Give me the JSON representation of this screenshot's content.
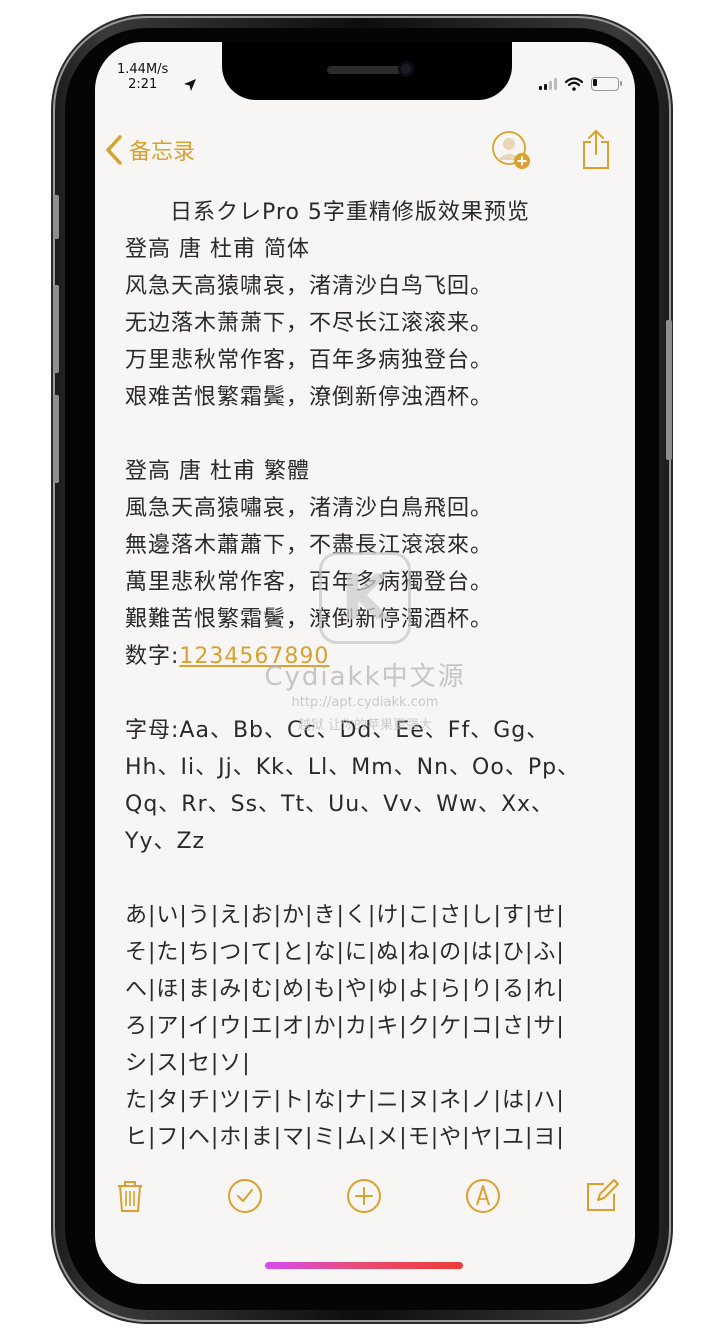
{
  "status_bar": {
    "speed": "1.44M/s",
    "time": "2:21"
  },
  "nav": {
    "back_label": "备忘录"
  },
  "note": {
    "lines": [
      "日系クレPro 5字重精修版效果预览",
      "登高 唐 杜甫 简体",
      "风急天高猿啸哀，渚清沙白鸟飞回。",
      "无边落木萧萧下，不尽长江滚滚来。",
      "万里悲秋常作客，百年多病独登台。",
      "艰难苦恨繁霜鬓，潦倒新停浊酒杯。",
      "",
      "登高 唐 杜甫 繁體",
      "風急天高猿嘯哀，渚清沙白鳥飛回。",
      "無邊落木蕭蕭下，不盡長江滾滾來。",
      "萬里悲秋常作客，百年多病獨登台。",
      "艱難苦恨繁霜鬢，潦倒新停濁酒杯。"
    ],
    "digits_label": "数字:",
    "digits_value": "1234567890",
    "letters": [
      "字母:Aa、Bb、Cc、Dd、Ee、Ff、Gg、",
      "Hh、Ii、Jj、Kk、Ll、Mm、Nn、Oo、Pp、",
      "Qq、Rr、Ss、Tt、Uu、Vv、Ww、Xx、",
      "Yy、Zz"
    ],
    "kana": [
      "あ|い|う|え|お|か|き|く|け|こ|さ|し|す|せ|",
      "そ|た|ち|つ|て|と|な|に|ぬ|ね|の|は|ひ|ふ|",
      "へ|ほ|ま|み|む|め|も|や|ゆ|よ|ら|り|る|れ|",
      "ろ|ア|イ|ウ|エ|オ|か|カ|キ|ク|ケ|コ|さ|サ|",
      "シ|ス|セ|ソ|",
      "た|タ|チ|ツ|テ|ト|な|ナ|ニ|ヌ|ネ|ノ|は|ハ|",
      "ヒ|フ|ヘ|ホ|ま|マ|ミ|ム|メ|モ|や|ヤ|ユ|ヨ|"
    ]
  },
  "watermark": {
    "logo_letter": "K",
    "name": "Cydiakk中文源",
    "url": "http://apt.cydiakk.com",
    "slogan": "越狱 让你的苹果更强大"
  },
  "toolbar": {
    "icons": [
      "trash-icon",
      "checklist-icon",
      "add-icon",
      "markup-icon",
      "compose-icon"
    ]
  },
  "colors": {
    "accent": "#d9a12d",
    "text": "#2a2a2a",
    "paper": "#f7f6f4"
  }
}
